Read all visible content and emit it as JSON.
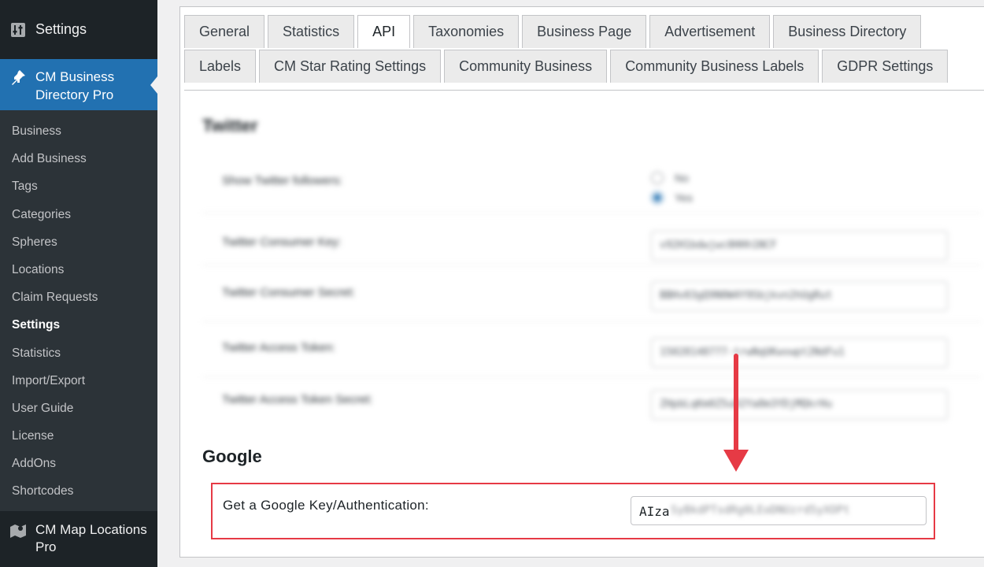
{
  "sidebar": {
    "settings_label": "Settings",
    "plugin_label_line1": "CM Business",
    "plugin_label_line2": "Directory Pro",
    "items": [
      {
        "label": "Business"
      },
      {
        "label": "Add Business"
      },
      {
        "label": "Tags"
      },
      {
        "label": "Categories"
      },
      {
        "label": "Spheres"
      },
      {
        "label": "Locations"
      },
      {
        "label": "Claim Requests"
      },
      {
        "label": "Settings",
        "current": true
      },
      {
        "label": "Statistics"
      },
      {
        "label": "Import/Export"
      },
      {
        "label": "User Guide"
      },
      {
        "label": "License"
      },
      {
        "label": "AddOns"
      },
      {
        "label": "Shortcodes"
      }
    ],
    "map_label_line1": "CM Map Locations",
    "map_label_line2": "Pro"
  },
  "tabs": {
    "row1": [
      "General",
      "Statistics",
      "API",
      "Taxonomies",
      "Business Page",
      "Advertisement",
      "Business Directory"
    ],
    "row2": [
      "Labels",
      "CM Star Rating Settings",
      "Community Business",
      "Community Business Labels",
      "GDPR Settings"
    ],
    "active": "API"
  },
  "twitter": {
    "heading": "Twitter",
    "followers_label": "Show Twitter followers:",
    "followers_options": [
      "No",
      "Yes"
    ],
    "followers_selected": "Yes",
    "consumer_key_label": "Twitter Consumer Key:",
    "consumer_key_value": "v92H1bdwjwc0HHh1NCF",
    "consumer_secret_label": "Twitter Consumer Secret:",
    "consumer_secret_value": "BBHv03gQ9N0W4Y9Sbjkvn2hUgRut",
    "access_token_label": "Twitter Access Token:",
    "access_token_value": "15028148777-trwNqUKwvwpt2NdFu1",
    "access_token_secret_label": "Twitter Access Token Secret:",
    "access_token_secret_value": "ZHpbLqKm0Z5uD2Ya8m3YDjMQkrHu"
  },
  "google": {
    "heading": "Google",
    "key_label": "Get a Google Key/Authentication:",
    "key_value_prefix": "AIza",
    "key_value_rest": "SyBkdPTsdRg0LEoDNUzrd5yXOPt"
  },
  "colors": {
    "sidebar_bg": "#1d2327",
    "sidebar_active": "#2271b1",
    "highlight_box": "#e63a45"
  }
}
